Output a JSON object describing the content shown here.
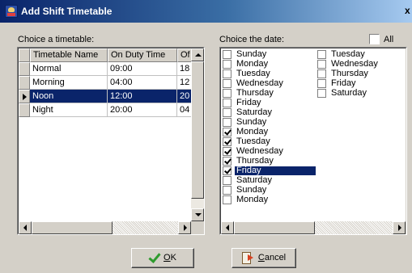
{
  "window": {
    "title": "Add Shift Timetable",
    "close_glyph": "x"
  },
  "timetable": {
    "label": "Choice a timetable:",
    "columns": [
      "Timetable Name",
      "On Duty Time",
      "Of"
    ],
    "rows": [
      {
        "name": "Normal",
        "on_duty": "09:00",
        "off": "18",
        "current": false
      },
      {
        "name": "Morning",
        "on_duty": "04:00",
        "off": "12",
        "current": false
      },
      {
        "name": "Noon",
        "on_duty": "12:00",
        "off": "20",
        "current": true
      },
      {
        "name": "Night",
        "on_duty": "20:00",
        "off": "04",
        "current": false
      }
    ]
  },
  "dates": {
    "label": "Choice the date:",
    "all_label": "All",
    "all_checked": false,
    "col1": [
      {
        "day": "Sunday",
        "checked": false
      },
      {
        "day": "Monday",
        "checked": false
      },
      {
        "day": "Tuesday",
        "checked": false
      },
      {
        "day": "Wednesday",
        "checked": false
      },
      {
        "day": "Thursday",
        "checked": false
      },
      {
        "day": "Friday",
        "checked": false
      },
      {
        "day": "Saturday",
        "checked": false
      },
      {
        "day": "Sunday",
        "checked": false
      },
      {
        "day": "Monday",
        "checked": true
      },
      {
        "day": "Tuesday",
        "checked": true
      },
      {
        "day": "Wednesday",
        "checked": true
      },
      {
        "day": "Thursday",
        "checked": true
      },
      {
        "day": "Friday",
        "checked": true,
        "selected": true
      },
      {
        "day": "Saturday",
        "checked": false
      },
      {
        "day": "Sunday",
        "checked": false
      },
      {
        "day": "Monday",
        "checked": false
      }
    ],
    "col2": [
      {
        "day": "Tuesday",
        "checked": false
      },
      {
        "day": "Wednesday",
        "checked": false
      },
      {
        "day": "Thursday",
        "checked": false
      },
      {
        "day": "Friday",
        "checked": false
      },
      {
        "day": "Saturday",
        "checked": false
      }
    ]
  },
  "buttons": {
    "ok": {
      "label": "OK",
      "accel": "O",
      "rest": "K"
    },
    "cancel": {
      "label": "Cancel",
      "accel": "C",
      "rest": "ancel"
    }
  },
  "icons": {
    "app": "app-people-icon",
    "ok": "check-icon",
    "cancel": "exit-door-icon"
  },
  "colors": {
    "selection": "#0a246a",
    "titlebar_start": "#0a246a",
    "titlebar_end": "#a6caf0",
    "face": "#d4d0c8",
    "ok_check": "#2e9b2e"
  }
}
